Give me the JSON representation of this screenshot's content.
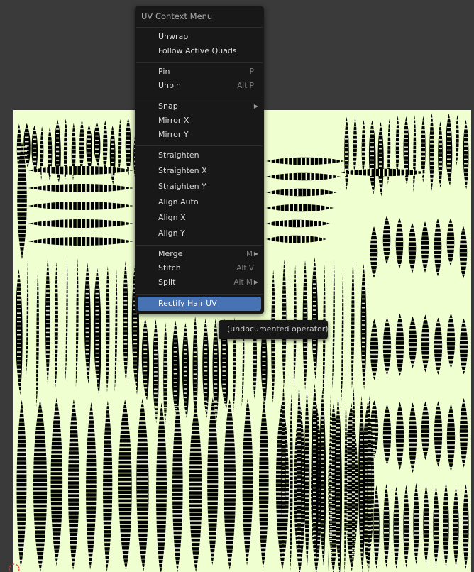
{
  "menu": {
    "title": "UV Context Menu",
    "items": [
      {
        "label": "Unwrap",
        "shortcut": "",
        "submenu": false
      },
      {
        "label": "Follow Active Quads",
        "shortcut": "",
        "submenu": false
      },
      {
        "label": "Pin",
        "shortcut": "P",
        "submenu": false
      },
      {
        "label": "Unpin",
        "shortcut": "Alt P",
        "submenu": false
      },
      {
        "label": "Snap",
        "shortcut": "",
        "submenu": true
      },
      {
        "label": "Mirror X",
        "shortcut": "",
        "submenu": false
      },
      {
        "label": "Mirror Y",
        "shortcut": "",
        "submenu": false
      },
      {
        "label": "Straighten",
        "shortcut": "",
        "submenu": false
      },
      {
        "label": "Straighten X",
        "shortcut": "",
        "submenu": false
      },
      {
        "label": "Straighten Y",
        "shortcut": "",
        "submenu": false
      },
      {
        "label": "Align Auto",
        "shortcut": "",
        "submenu": false
      },
      {
        "label": "Align X",
        "shortcut": "",
        "submenu": false
      },
      {
        "label": "Align Y",
        "shortcut": "",
        "submenu": false
      },
      {
        "label": "Merge",
        "shortcut": "M",
        "submenu": true
      },
      {
        "label": "Stitch",
        "shortcut": "Alt V",
        "submenu": false
      },
      {
        "label": "Split",
        "shortcut": "Alt M",
        "submenu": true
      },
      {
        "label": "Rectify Hair UV",
        "shortcut": "",
        "submenu": false,
        "active": true
      }
    ]
  },
  "tooltip": {
    "text": "(undocumented operator)."
  },
  "uv_editor": {
    "background_color": "#383838",
    "uv_tile_color": "#f0ffd0",
    "wire_color": "#000000",
    "highlight_color": "#4772b3"
  }
}
